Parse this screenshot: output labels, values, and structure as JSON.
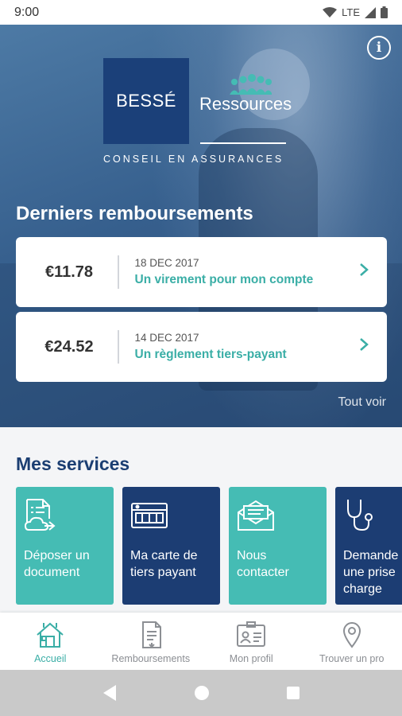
{
  "status_bar": {
    "time": "9:00",
    "network": "LTE"
  },
  "brand": {
    "name": "BESSÉ",
    "product": "Ressources",
    "tagline": "CONSEIL EN ASSURANCES"
  },
  "reimbursements": {
    "title": "Derniers remboursements",
    "see_all": "Tout voir",
    "items": [
      {
        "amount": "€11.78",
        "date": "18 DEC 2017",
        "label": "Un virement pour mon compte"
      },
      {
        "amount": "€24.52",
        "date": "14 DEC 2017",
        "label": "Un règlement tiers-payant"
      }
    ]
  },
  "services": {
    "title": "Mes services",
    "tiles": [
      {
        "line1": "Déposer un",
        "line2": "document",
        "line3": "",
        "icon": "document-upload-icon",
        "color": "#45bcb4"
      },
      {
        "line1": "Ma carte de",
        "line2": "tiers payant",
        "line3": "",
        "icon": "card-icon",
        "color": "#1c3d73"
      },
      {
        "line1": "Nous",
        "line2": "contacter",
        "line3": "",
        "icon": "envelope-icon",
        "color": "#45bcb4"
      },
      {
        "line1": "Demande",
        "line2": "une prise",
        "line3": "charge",
        "icon": "stethoscope-icon",
        "color": "#1c3d73"
      }
    ]
  },
  "bottom_nav": {
    "items": [
      {
        "label": "Accueil",
        "icon": "home-icon",
        "active": true
      },
      {
        "label": "Remboursements",
        "icon": "receipt-icon",
        "active": false
      },
      {
        "label": "Mon profil",
        "icon": "id-card-icon",
        "active": false
      },
      {
        "label": "Trouver un pro",
        "icon": "map-pin-icon",
        "active": false
      }
    ]
  },
  "colors": {
    "teal": "#45bcb4",
    "navy": "#1c3d73",
    "accent_text": "#3aaea6"
  }
}
